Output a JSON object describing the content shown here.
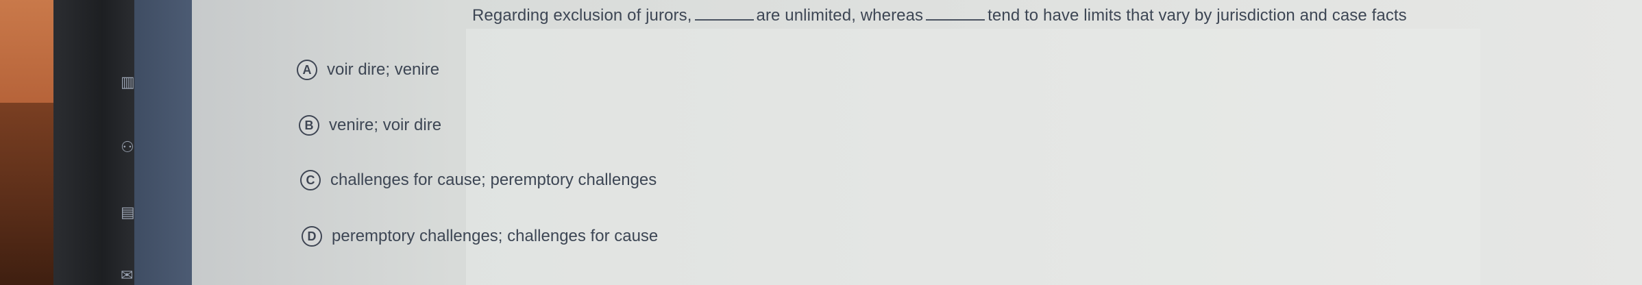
{
  "question": {
    "part1": "Regarding exclusion of jurors,",
    "part2": "are unlimited, whereas",
    "part3": "tend to have limits that vary by jurisdiction and case facts"
  },
  "options": [
    {
      "letter": "A",
      "text": "voir dire; venire"
    },
    {
      "letter": "B",
      "text": "venire; voir dire"
    },
    {
      "letter": "C",
      "text": "challenges for cause; peremptory challenges"
    },
    {
      "letter": "D",
      "text": "peremptory challenges; challenges for cause"
    }
  ],
  "colors": {
    "text": "#3d4654",
    "sidebar": "#4c5b73",
    "background": "#dfe1df"
  }
}
